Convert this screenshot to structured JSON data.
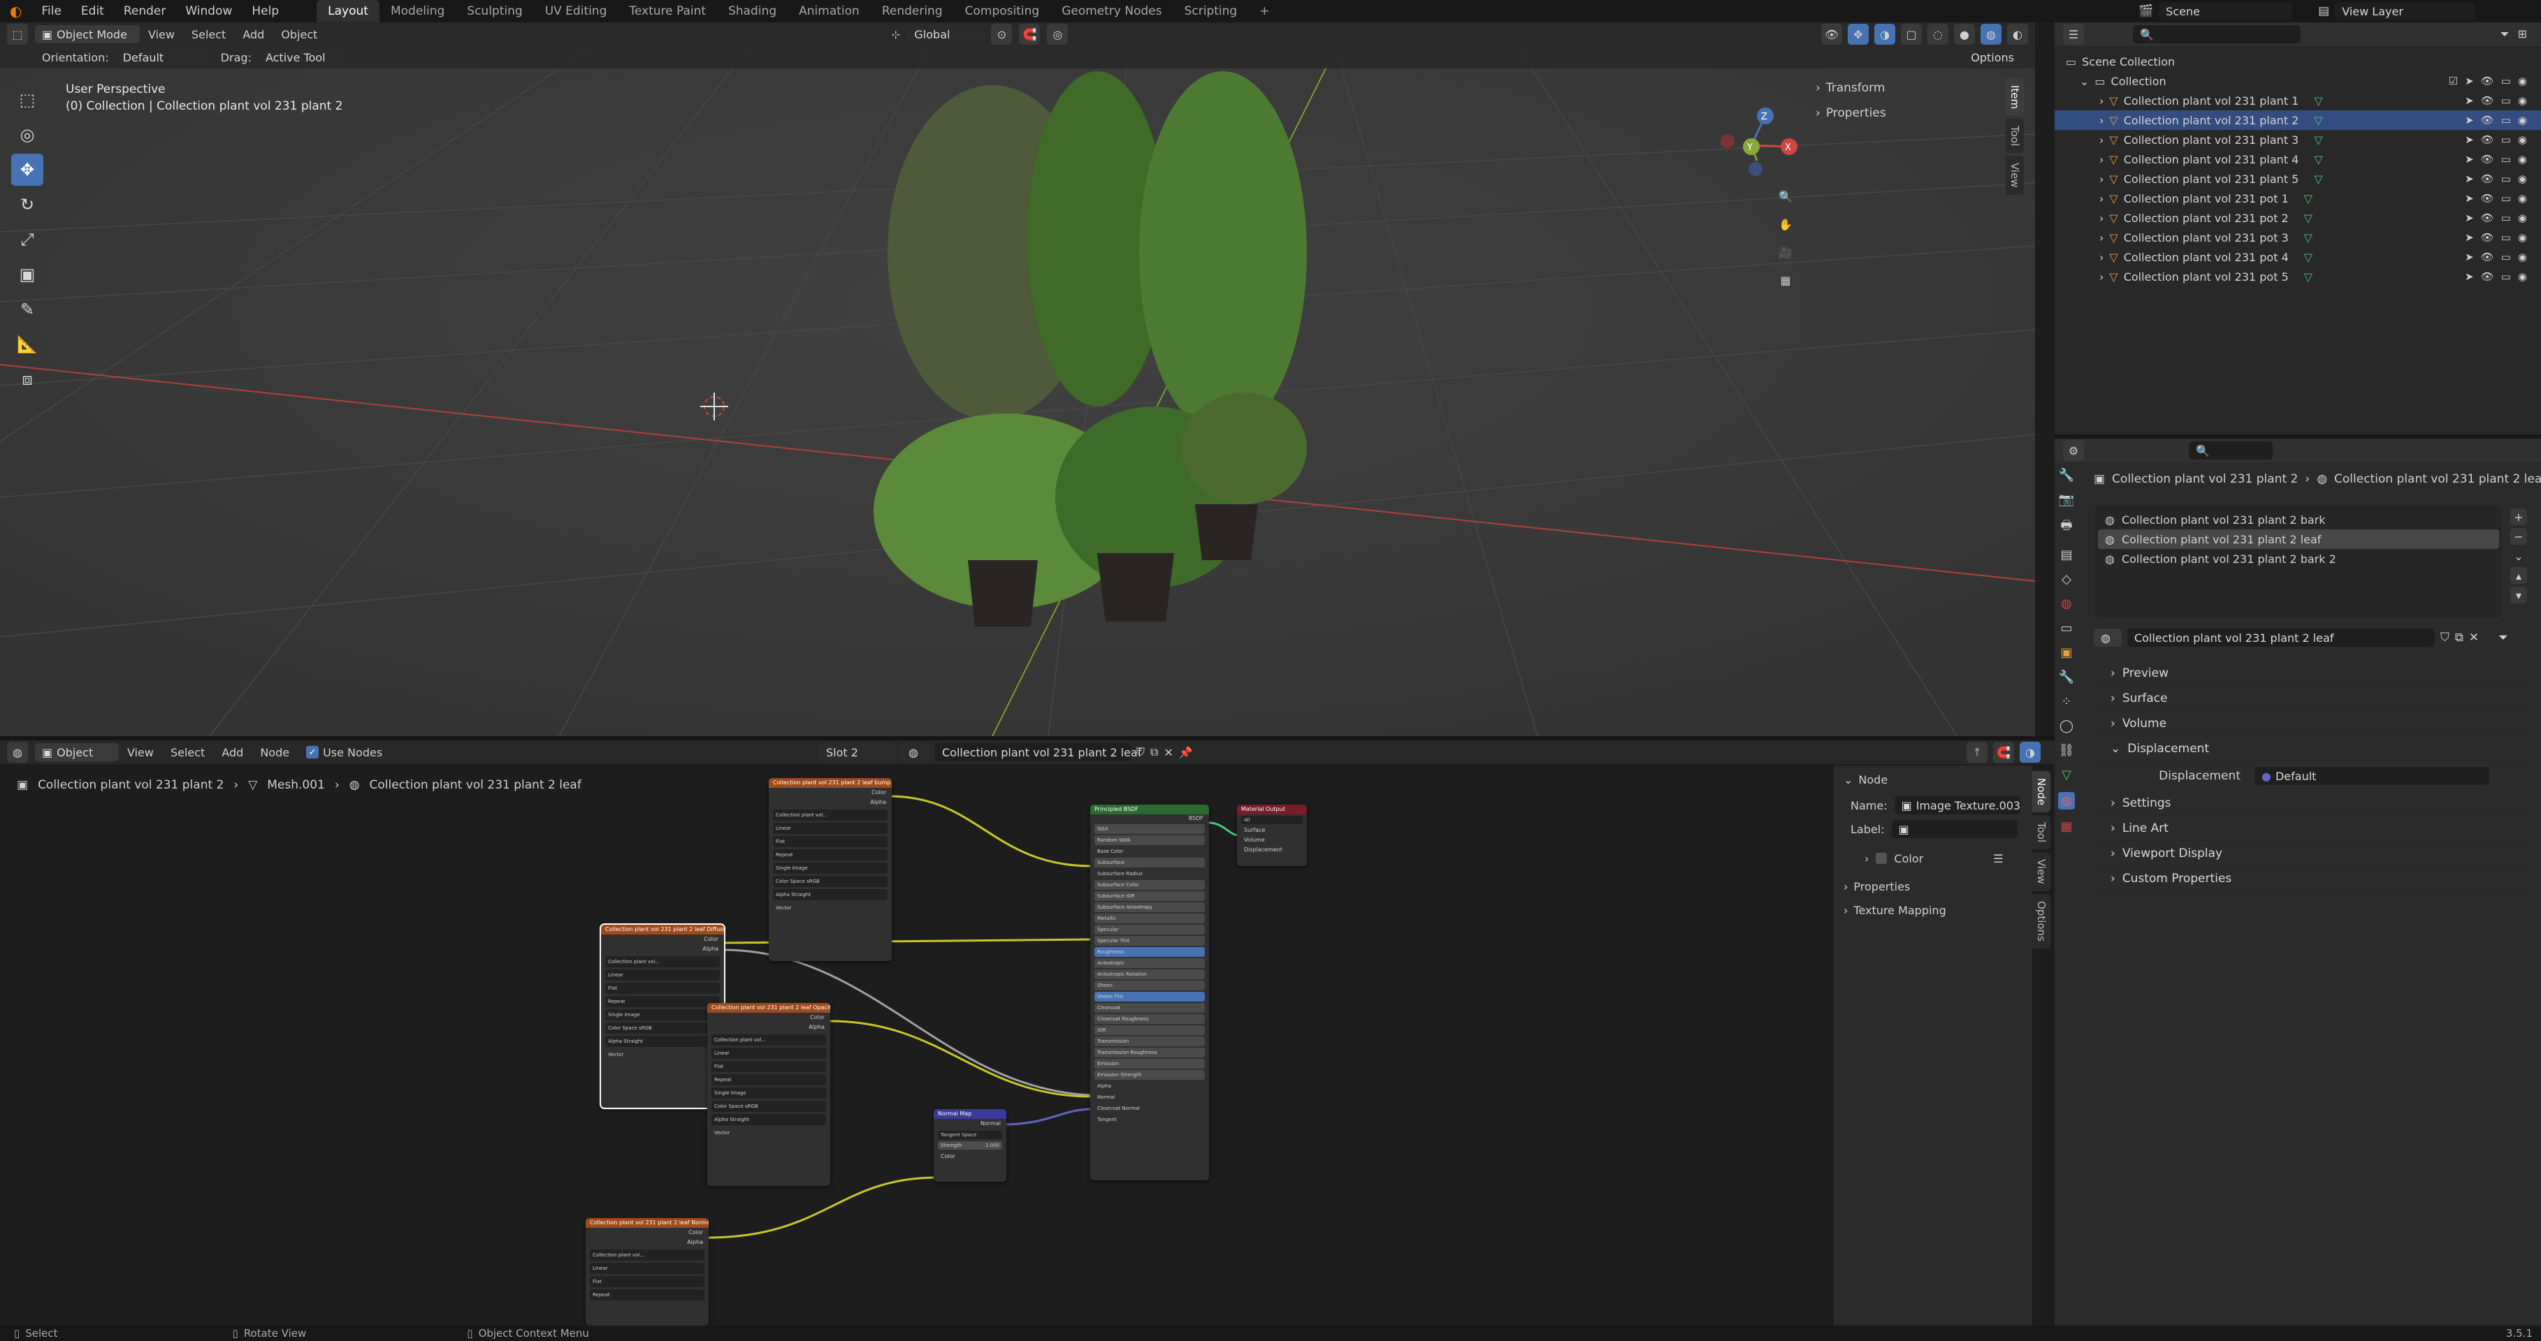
{
  "top_menu": [
    "File",
    "Edit",
    "Render",
    "Window",
    "Help"
  ],
  "workspaces": [
    "Layout",
    "Modeling",
    "Sculpting",
    "UV Editing",
    "Texture Paint",
    "Shading",
    "Animation",
    "Rendering",
    "Compositing",
    "Geometry Nodes",
    "Scripting"
  ],
  "add_workspace": "+",
  "scene_name": "Scene",
  "view_layer": "View Layer",
  "viewport": {
    "mode": "Object Mode",
    "menus": [
      "View",
      "Select",
      "Add",
      "Object"
    ],
    "transform_space": "Global",
    "orientation_label": "Orientation:",
    "orientation_value": "Default",
    "drag_label": "Drag:",
    "drag_value": "Active Tool",
    "options": "Options",
    "perspective": "User Perspective",
    "context": "(0) Collection | Collection plant vol 231 plant 2",
    "n_panel": [
      "Transform",
      "Properties"
    ],
    "side_tabs": [
      "Item",
      "Tool",
      "View"
    ],
    "gizmo": {
      "x": "X",
      "y": "Y",
      "z": "Z"
    }
  },
  "outliner": {
    "root": "Scene Collection",
    "collection": "Collection",
    "items": [
      "Collection plant vol 231 plant 1",
      "Collection plant vol 231 plant 2",
      "Collection plant vol 231 plant 3",
      "Collection plant vol 231 plant 4",
      "Collection plant vol 231 plant 5",
      "Collection plant vol 231 pot 1",
      "Collection plant vol 231 pot 2",
      "Collection plant vol 231 pot 3",
      "Collection plant vol 231 pot 4",
      "Collection plant vol 231 pot 5"
    ]
  },
  "properties": {
    "breadcrumb_obj": "Collection plant vol 231 plant 2",
    "breadcrumb_mat": "Collection plant vol 231 plant 2 leaf",
    "slots": [
      "Collection plant vol 231 plant 2 bark",
      "Collection plant vol 231 plant 2 leaf",
      "Collection plant vol 231 plant 2 bark 2"
    ],
    "active_slot": 1,
    "material_name": "Collection plant vol 231 plant 2 leaf",
    "panels": [
      "Preview",
      "Surface",
      "Volume",
      "Displacement"
    ],
    "displacement_label": "Displacement",
    "displacement_value": "Default",
    "panels_after": [
      "Settings",
      "Line Art",
      "Viewport Display",
      "Custom Properties"
    ]
  },
  "node_editor": {
    "editor_type": "Object",
    "menus": [
      "View",
      "Select",
      "Add",
      "Node"
    ],
    "use_nodes": "Use Nodes",
    "slot": "Slot 2",
    "material": "Collection plant vol 231 plant 2 leaf",
    "breadcrumb": [
      "Collection plant vol 231 plant 2",
      "Mesh.001",
      "Collection plant vol 231 plant 2 leaf"
    ],
    "sidebar": {
      "section": "Node",
      "name_label": "Name:",
      "name_value": "Image Texture.003",
      "label_label": "Label:",
      "color": "Color",
      "properties": "Properties",
      "texture_mapping": "Texture Mapping"
    },
    "side_tabs": [
      "Node",
      "Tool",
      "View",
      "Options"
    ],
    "nodes": {
      "tex1": "Collection plant vol 231 plant 2 leaf bump",
      "tex2": "Collection plant vol 231 plant 2 leaf Diffuse",
      "tex3": "Collection plant vol 231 plant 2 leaf Opacity",
      "tex4": "Collection plant vol 231 plant 2 leaf Normal",
      "bsdf": "Principled BSDF",
      "output": "Material Output",
      "normal_map": "Normal Map",
      "tex_rows": [
        "Linear",
        "Flat",
        "Repeat",
        "Single Image"
      ],
      "color_space": "Color Space",
      "color_space_val": "sRGB",
      "alpha": "Alpha",
      "alpha_val": "Straight",
      "vector": "Vector",
      "out_color": "Color",
      "out_alpha": "Alpha",
      "tex_file": "Collection plant vol...",
      "bsdf_rows": [
        "GGX",
        "Random Walk",
        "Base Color",
        "Subsurface",
        "Subsurface Radius",
        "Subsurface Color",
        "Subsurface IOR",
        "Subsurface Anisotropy",
        "Metallic",
        "Specular",
        "Specular Tint",
        "Roughness",
        "Anisotropic",
        "Anisotropic Rotation",
        "Sheen",
        "Sheen Tint",
        "Clearcoat",
        "Clearcoat Roughness",
        "IOR",
        "Transmission",
        "Transmission Roughness",
        "Emission",
        "Emission Strength",
        "Alpha",
        "Normal",
        "Clearcoat Normal",
        "Tangent"
      ],
      "bsdf_out": "BSDF",
      "output_rows": [
        "All",
        "Surface",
        "Volume",
        "Displacement"
      ],
      "normal_rows": [
        "Tangent Space",
        "Strength",
        "Color"
      ],
      "normal_out": "Normal",
      "strength_val": "1.000"
    }
  },
  "status_bar": {
    "left": "Select",
    "middle": "Rotate View",
    "right": "Object Context Menu",
    "version": "3.5.1"
  },
  "colors": {
    "accent": "#4772b3",
    "texture_header": "#a04a1a",
    "shader_header": "#2b6a31",
    "output_header": "#7a1d2a",
    "vector_header": "#3a3a9a",
    "link_yellow": "#c7c729",
    "link_gray": "#a0a0a0"
  }
}
